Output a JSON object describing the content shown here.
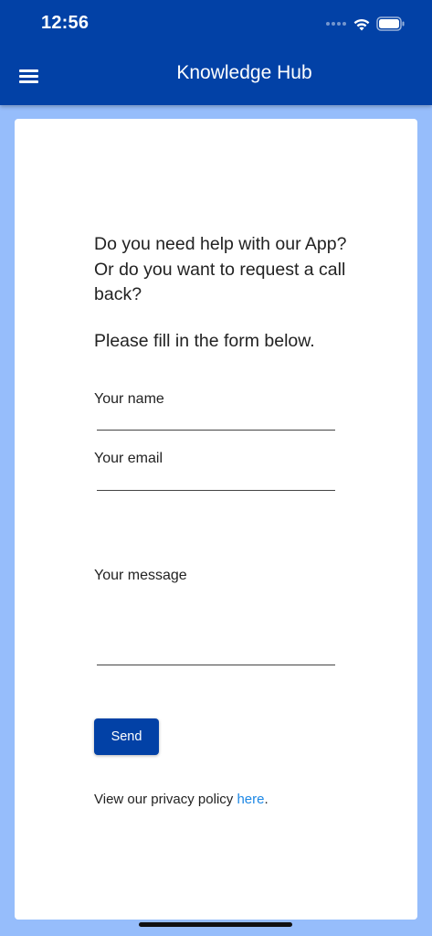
{
  "status_bar": {
    "time": "12:56"
  },
  "header": {
    "title": "Knowledge Hub",
    "menu_icon": "hamburger-menu-icon"
  },
  "form": {
    "intro": "Do you need help with our App? Or do you want to request a call back?",
    "instruction": "Please fill in the form below.",
    "name_label": "Your name",
    "name_value": "",
    "email_label": "Your email",
    "email_value": "",
    "message_label": "Your message",
    "message_value": "",
    "send_label": "Send"
  },
  "footer": {
    "privacy_text": "View our privacy policy ",
    "privacy_link": "here",
    "privacy_end": "."
  },
  "colors": {
    "header": "#0241a6",
    "background": "#96bdfb",
    "link": "#1e88e5"
  }
}
